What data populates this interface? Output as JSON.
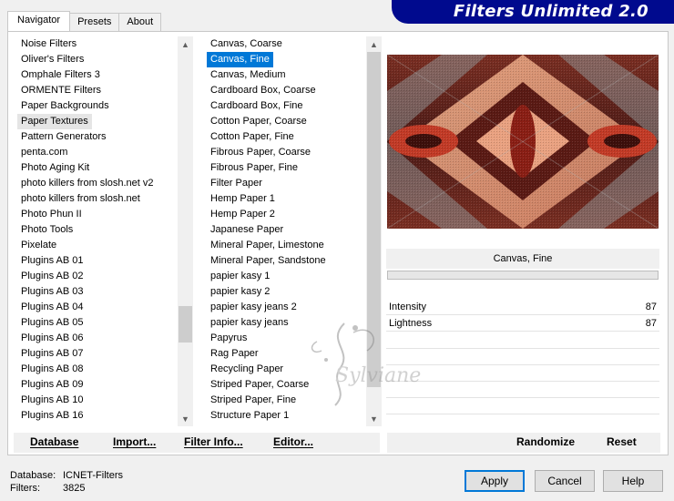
{
  "tabs": [
    "Navigator",
    "Presets",
    "About"
  ],
  "banner_title": "Filters Unlimited 2.0",
  "categories": [
    "Noise Filters",
    "Oliver's Filters",
    "Omphale Filters 3",
    "ORMENTE Filters",
    "Paper Backgrounds",
    "Paper Textures",
    "Pattern Generators",
    "penta.com",
    "Photo Aging Kit",
    "photo killers from slosh.net v2",
    "photo killers from slosh.net",
    "Photo Phun II",
    "Photo Tools",
    "Pixelate",
    "Plugins AB 01",
    "Plugins AB 02",
    "Plugins AB 03",
    "Plugins AB 04",
    "Plugins AB 05",
    "Plugins AB 06",
    "Plugins AB 07",
    "Plugins AB 08",
    "Plugins AB 09",
    "Plugins AB 10",
    "Plugins AB 16"
  ],
  "selected_category": "Paper Textures",
  "filters": [
    "Canvas, Coarse",
    "Canvas, Fine",
    "Canvas, Medium",
    "Cardboard Box, Coarse",
    "Cardboard Box, Fine",
    "Cotton Paper, Coarse",
    "Cotton Paper, Fine",
    "Fibrous Paper, Coarse",
    "Fibrous Paper, Fine",
    "Filter Paper",
    "Hemp Paper 1",
    "Hemp Paper 2",
    "Japanese Paper",
    "Mineral Paper, Limestone",
    "Mineral Paper, Sandstone",
    "papier kasy 1",
    "papier kasy 2",
    "papier kasy jeans 2",
    "papier kasy jeans",
    "Papyrus",
    "Rag Paper",
    "Recycling Paper",
    "Striped Paper, Coarse",
    "Striped Paper, Fine",
    "Structure Paper 1"
  ],
  "selected_filter": "Canvas, Fine",
  "current_filter_name": "Canvas, Fine",
  "params": [
    {
      "label": "Intensity",
      "value": "87"
    },
    {
      "label": "Lightness",
      "value": "87"
    }
  ],
  "actions": {
    "database": "Database",
    "import": "Import...",
    "filter_info": "Filter Info...",
    "editor": "Editor...",
    "randomize": "Randomize",
    "reset": "Reset"
  },
  "status": {
    "database_label": "Database:",
    "database_value": "ICNET-Filters",
    "filters_label": "Filters:",
    "filters_value": "3825"
  },
  "buttons": {
    "apply": "Apply",
    "cancel": "Cancel",
    "help": "Help"
  },
  "watermark": "Sylviane",
  "colors": {
    "banner": "#000a8e",
    "selection": "#0078d7"
  }
}
